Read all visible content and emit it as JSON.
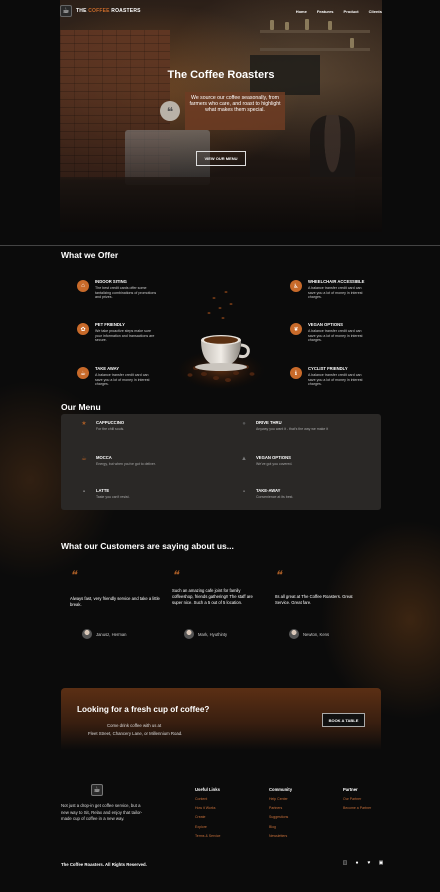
{
  "nav": {
    "brand_prefix": "THE",
    "brand_accent": "COFFEE",
    "brand_suffix": "ROASTERS",
    "links": [
      "Home",
      "Features",
      "Product",
      "Clients"
    ]
  },
  "hero": {
    "title": "The Coffee Roasters",
    "quote": "We source our coffee seasonally, from farmers who care, and roast to highlight what makes them special.",
    "button": "VIEW OUR MENU"
  },
  "offer": {
    "title": "What we Offer",
    "items": [
      {
        "title": "INDOOR SITING",
        "desc": "The best credit cards offer some tantalizing combinations of promotions and prizes."
      },
      {
        "title": "PET FRIENDLY",
        "desc": "We take proactive steps make sure your information and transactions are secure."
      },
      {
        "title": "TAKE AWAY",
        "desc": "A balance transfer credit card can save you a lot of money in interest charges."
      },
      {
        "title": "WHEELCHAIR ACCESSIBLE",
        "desc": "A balance transfer credit card can save you a lot of money in interest charges."
      },
      {
        "title": "VEGAN OPTIONS",
        "desc": "A balance transfer credit card can save you a lot of money in interest charges."
      },
      {
        "title": "CYCLIST FRIENDLY",
        "desc": "A balance transfer credit card can save you a lot of money in interest charges."
      }
    ]
  },
  "menu": {
    "title": "Our Menu",
    "items": [
      {
        "name": "CAPPUCCINO",
        "desc": "For the chill souls."
      },
      {
        "name": "MOCCA",
        "desc": "Energy, but when you've got to deliver."
      },
      {
        "name": "LATTE",
        "desc": "Taste you can't resist."
      },
      {
        "name": "DRIVE THRU",
        "desc": "Anyway you want it - that's the way we make it"
      },
      {
        "name": "VEGAN OPTIONS",
        "desc": "We've got you covered."
      },
      {
        "name": "TAKE-AWAY",
        "desc": "Convenience at its best."
      }
    ]
  },
  "testimonials": {
    "title": "What our Customers are saying about us...",
    "items": [
      {
        "text": "Always fast, very friendly service and take a little break.",
        "author": "Janusz, Herman"
      },
      {
        "text": "Such an amazing cafe joint for family coffeeshop, friends gathering!! The staff are super nice. Such a 5 out of 5 location.",
        "author": "Mark, Hyuthinty"
      },
      {
        "text": "Its all great at The Coffee Roasters. Great Service. Great fare.",
        "author": "Newton, Kens"
      }
    ]
  },
  "cta": {
    "title": "Looking for a fresh cup of coffee?",
    "line1": "Come drink coffee with us at",
    "line2": "Fleet Street, Chancery Lane, or Millennium Road.",
    "button": "BOOK A TABLE"
  },
  "footer": {
    "desc": "Not just a drop-in get coffee service, but a new way to Sit, Relax and enjoy that tailor-made cup of coffee in a new way.",
    "cols": [
      {
        "title": "Useful Links",
        "links": [
          "Content",
          "How it Works",
          "Create",
          "Explore",
          "Terms & Service"
        ]
      },
      {
        "title": "Community",
        "links": [
          "Help Center",
          "Partners",
          "Suggestions",
          "Blog",
          "Newsletters"
        ]
      },
      {
        "title": "Partner",
        "links": [
          "Our Partner",
          "Become a Partner"
        ]
      }
    ],
    "copyright": "The Coffee Roasters. All Rights Reserved.",
    "socials": [
      "instagram-icon",
      "facebook-icon",
      "twitter-icon",
      "linkedin-icon"
    ]
  }
}
